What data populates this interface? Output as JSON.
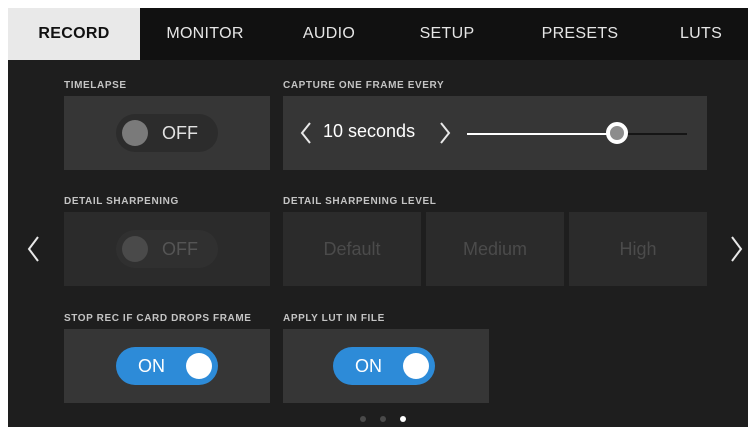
{
  "tabs": [
    {
      "label": "RECORD",
      "active": true
    },
    {
      "label": "MONITOR",
      "active": false
    },
    {
      "label": "AUDIO",
      "active": false
    },
    {
      "label": "SETUP",
      "active": false
    },
    {
      "label": "PRESETS",
      "active": false
    },
    {
      "label": "LUTS",
      "active": false
    }
  ],
  "timelapse": {
    "label": "TIMELAPSE",
    "state": "OFF"
  },
  "capture": {
    "label": "CAPTURE ONE FRAME EVERY",
    "value": "10 seconds",
    "slider_level": 0.68
  },
  "detail_sharpening": {
    "label": "DETAIL SHARPENING",
    "state": "OFF"
  },
  "sharpening_level": {
    "label": "DETAIL SHARPENING LEVEL",
    "options": [
      "Default",
      "Medium",
      "High"
    ]
  },
  "stop_rec": {
    "label": "STOP REC IF CARD DROPS FRAME",
    "state": "ON"
  },
  "apply_lut": {
    "label": "APPLY LUT IN FILE",
    "state": "ON"
  },
  "pagination": {
    "total": 3,
    "current": 3
  },
  "colors": {
    "accent": "#2d8bd8",
    "panel": "#1e1e1e",
    "tab_active": "#e9e9e9"
  },
  "icons": {
    "prev_page": "chevron-left-icon",
    "next_page": "chevron-right-icon",
    "decrement": "chevron-left-icon",
    "increment": "chevron-right-icon"
  }
}
